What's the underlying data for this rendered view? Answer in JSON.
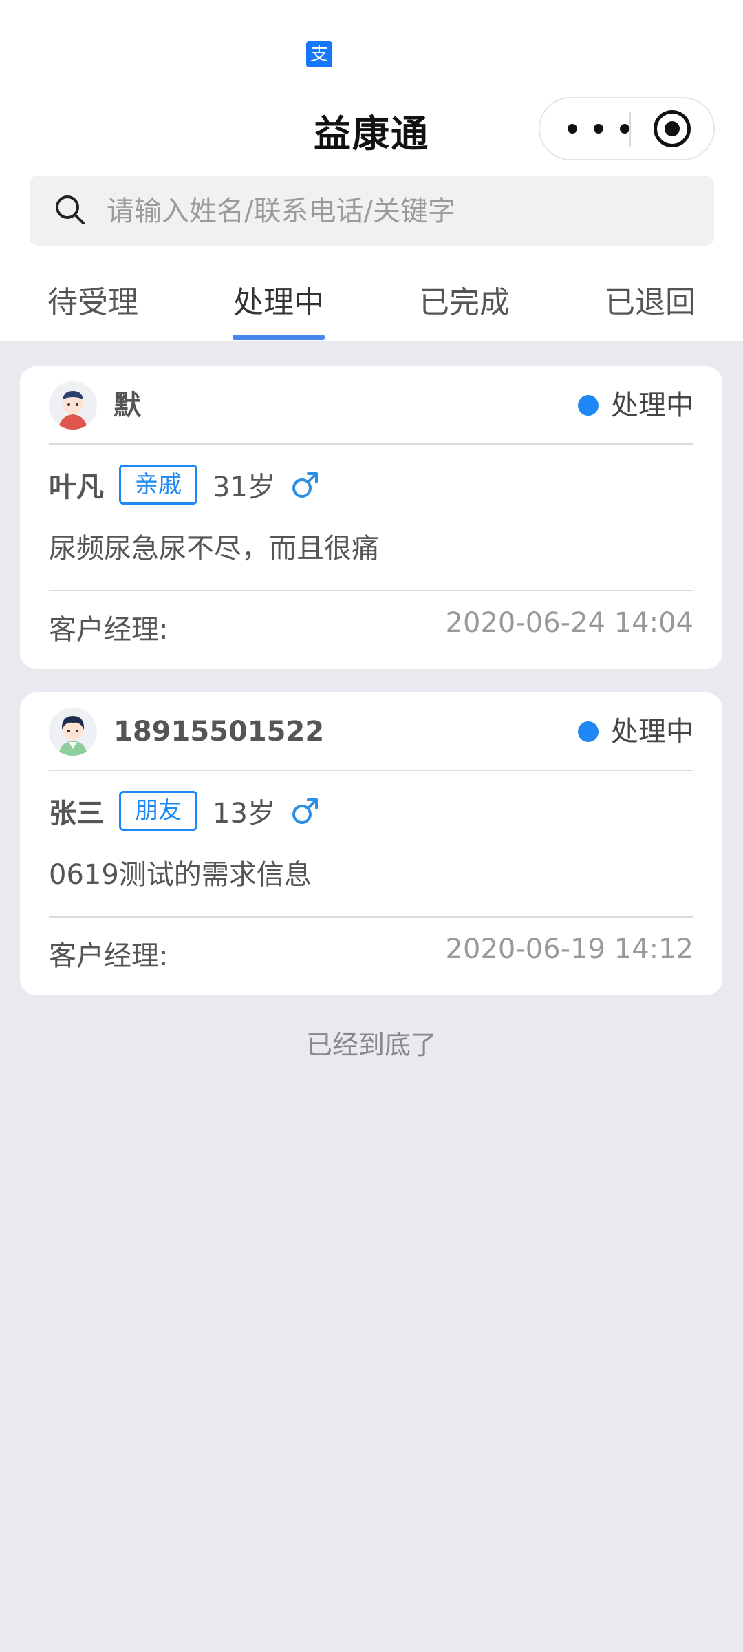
{
  "app": {
    "title": "益康通",
    "brand_icon_glyph": "支",
    "brand_color": "#1677ff",
    "accent_color": "#1e88f5"
  },
  "search": {
    "placeholder": "请输入姓名/联系电话/关键字"
  },
  "tabs": [
    {
      "label": "待受理",
      "active": false
    },
    {
      "label": "处理中",
      "active": true
    },
    {
      "label": "已完成",
      "active": false
    },
    {
      "label": "已退回",
      "active": false
    }
  ],
  "cards": [
    {
      "owner": "默",
      "status": "处理中",
      "patient_name": "叶凡",
      "relation": "亲戚",
      "age": "31岁",
      "gender_icon": "male-icon",
      "description": "尿频尿急尿不尽，而且很痛",
      "manager_label": "客户经理:",
      "time": "2020-06-24 14:04"
    },
    {
      "owner": "18915501522",
      "status": "处理中",
      "patient_name": "张三",
      "relation": "朋友",
      "age": "13岁",
      "gender_icon": "male-icon",
      "description": "0619测试的需求信息",
      "manager_label": "客户经理:",
      "time": "2020-06-19 14:12"
    }
  ],
  "footer": {
    "end_text": "已经到底了"
  }
}
